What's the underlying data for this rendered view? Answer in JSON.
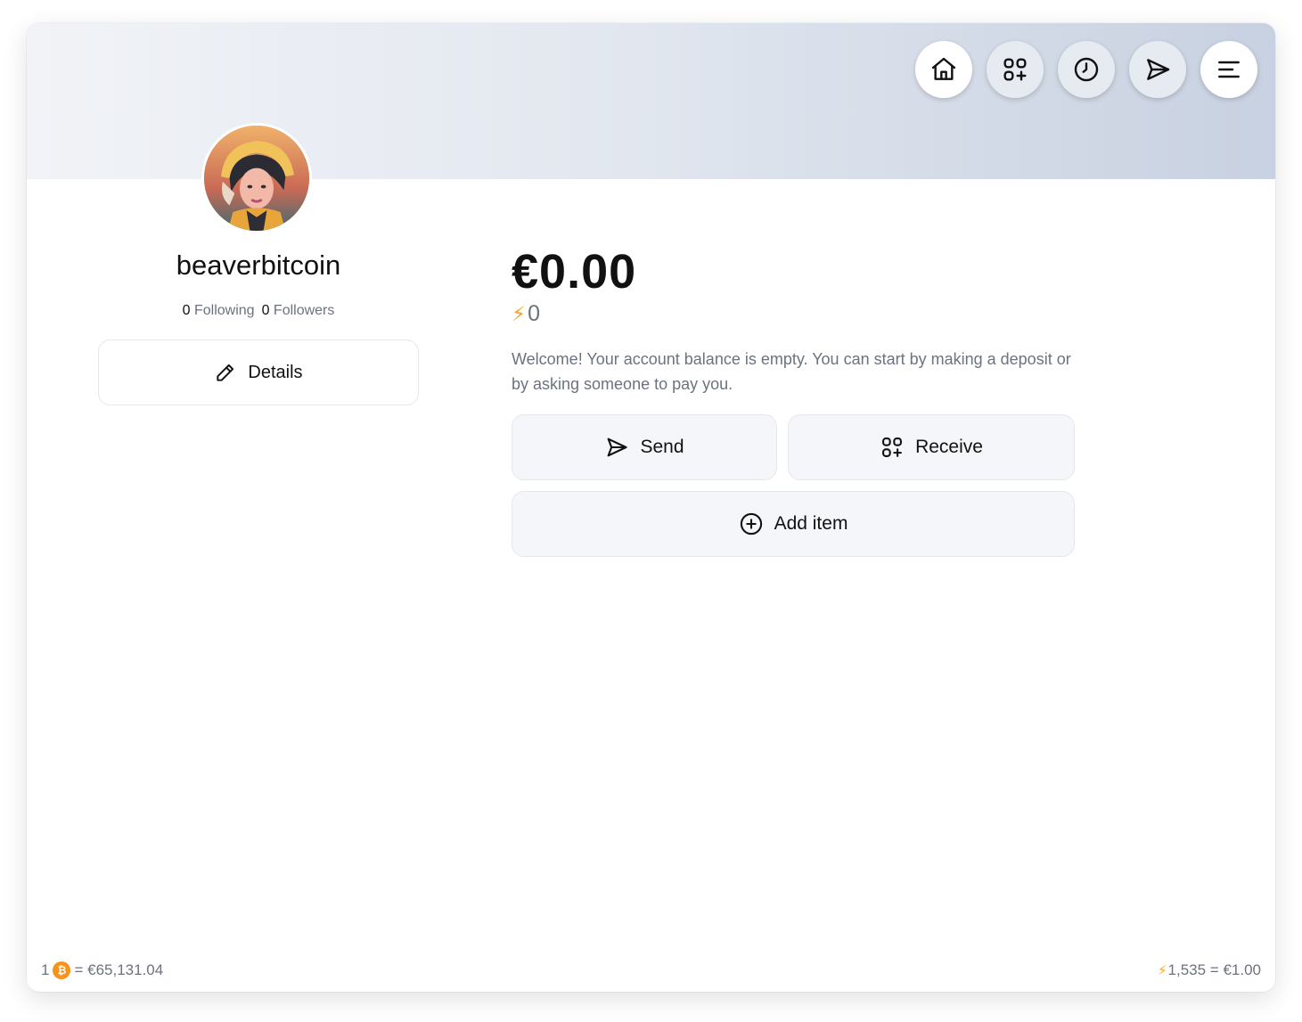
{
  "nav": {
    "items": [
      {
        "name": "home",
        "icon": "home-icon",
        "active": true
      },
      {
        "name": "receive",
        "icon": "qr-add-icon",
        "active": false
      },
      {
        "name": "history",
        "icon": "clock-icon",
        "active": false
      },
      {
        "name": "send",
        "icon": "send-icon",
        "active": false
      },
      {
        "name": "menu",
        "icon": "menu-icon",
        "active": true
      }
    ]
  },
  "profile": {
    "username": "beaverbitcoin",
    "following_count": "0",
    "following_label": "Following",
    "followers_count": "0",
    "followers_label": "Followers",
    "details_label": "Details"
  },
  "wallet": {
    "fiat_balance": "€0.00",
    "sats_balance": "0",
    "welcome_text": "Welcome! Your account balance is empty. You can start by making a deposit or by asking someone to pay you.",
    "send_label": "Send",
    "receive_label": "Receive",
    "add_item_label": "Add item"
  },
  "footer": {
    "btc_amount": "1",
    "btc_rate": "= €65,131.04",
    "sats_rate": "1,535 = €1.00"
  },
  "colors": {
    "accent_bolt": "#f5a524",
    "btc_orange": "#f7931a",
    "muted_text": "#6b7280",
    "button_bg": "#f5f6f9"
  }
}
